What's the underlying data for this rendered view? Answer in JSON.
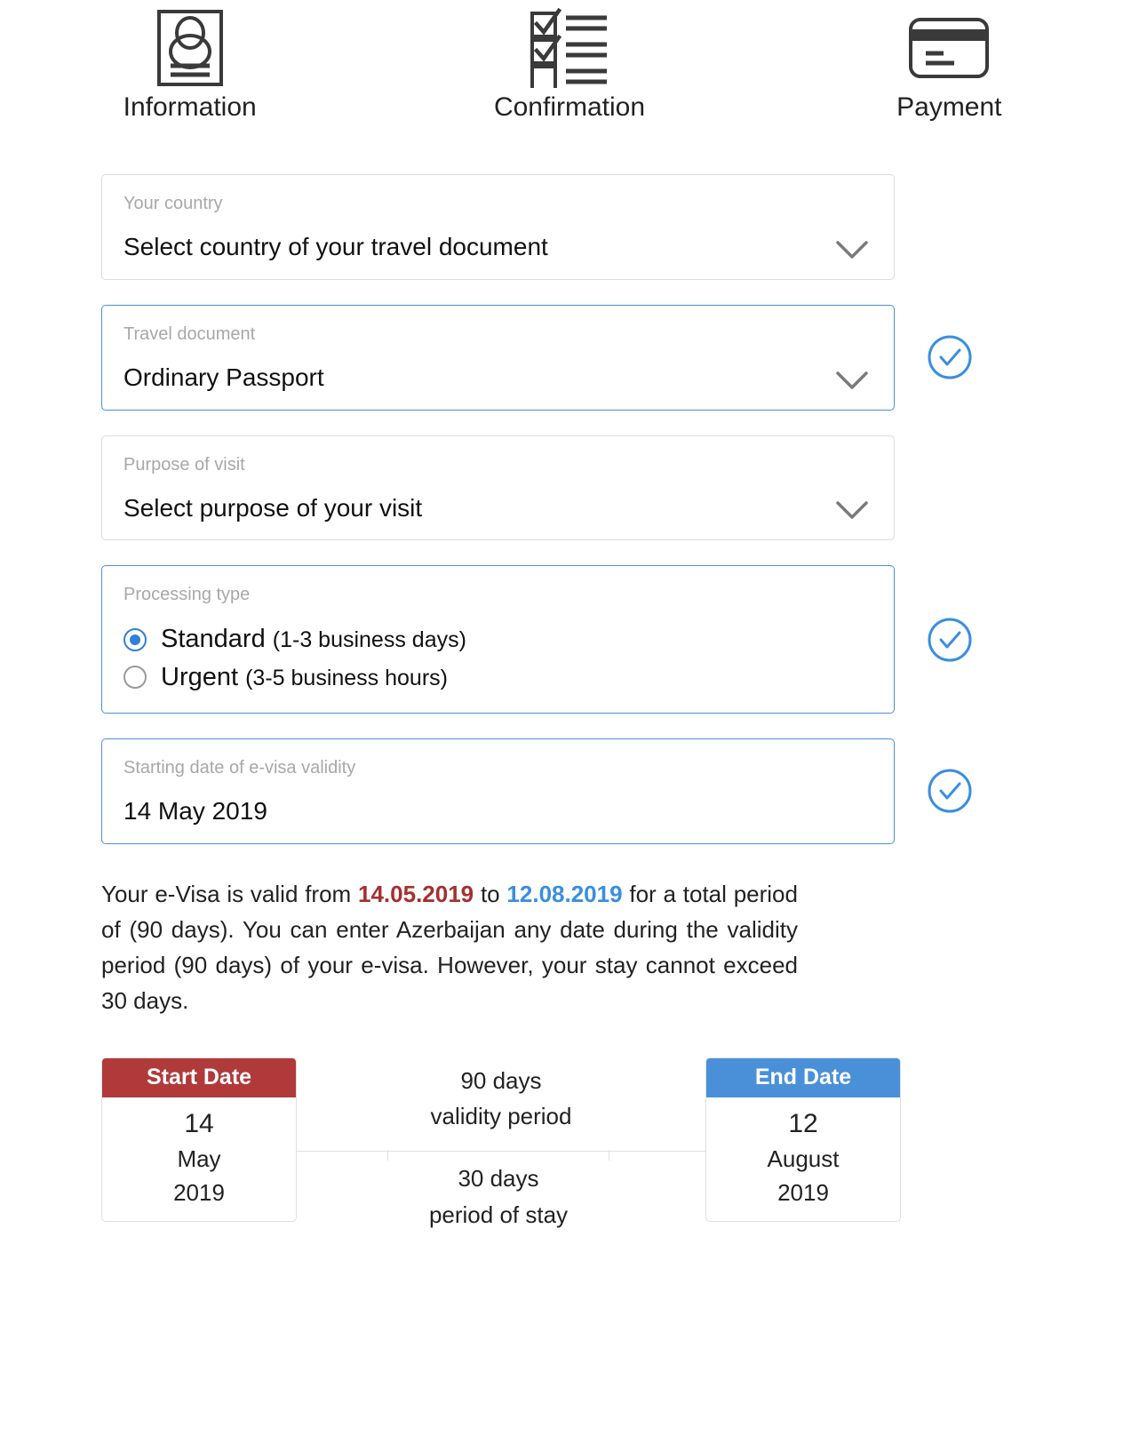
{
  "stepper": {
    "steps": [
      {
        "label": "Information",
        "icon": "document-person-icon"
      },
      {
        "label": "Confirmation",
        "icon": "checklist-icon"
      },
      {
        "label": "Payment",
        "icon": "credit-card-icon"
      }
    ]
  },
  "form": {
    "country": {
      "label": "Your country",
      "value": "Select country of your travel document",
      "valid": false
    },
    "travel_document": {
      "label": "Travel document",
      "value": "Ordinary Passport",
      "valid": true
    },
    "purpose": {
      "label": "Purpose of visit",
      "value": "Select purpose of your visit",
      "valid": false
    },
    "processing": {
      "label": "Processing type",
      "valid": true,
      "options": [
        {
          "name": "Standard",
          "detail": "(1-3 business days)",
          "selected": true
        },
        {
          "name": "Urgent",
          "detail": "(3-5 business hours)",
          "selected": false
        }
      ]
    },
    "start_date": {
      "label": "Starting date of e-visa validity",
      "value": "14 May 2019",
      "valid": true
    }
  },
  "notice": {
    "part1": "Your e-Visa is valid from ",
    "date_from": "14.05.2019",
    "part2": " to ",
    "date_to": "12.08.2019",
    "part3": " for a total period of (90 days). You can enter Azerbaijan any date during the validity period (90 days) of your e-visa. However, your stay cannot exceed 30 days."
  },
  "timeline": {
    "start_card": {
      "header": "Start Date",
      "day": "14",
      "month": "May",
      "year": "2019",
      "color": "#b03a3a"
    },
    "end_card": {
      "header": "End Date",
      "day": "12",
      "month": "August",
      "year": "2019",
      "color": "#4a90d9"
    },
    "validity": {
      "amount": "90 days",
      "label": "validity period"
    },
    "stay": {
      "amount": "30 days",
      "label": "period of stay"
    }
  },
  "colors": {
    "accent_blue": "#4a90d9",
    "start_red": "#b03a3a",
    "text_dark": "#222222",
    "label_gray": "#a8a8a8"
  }
}
